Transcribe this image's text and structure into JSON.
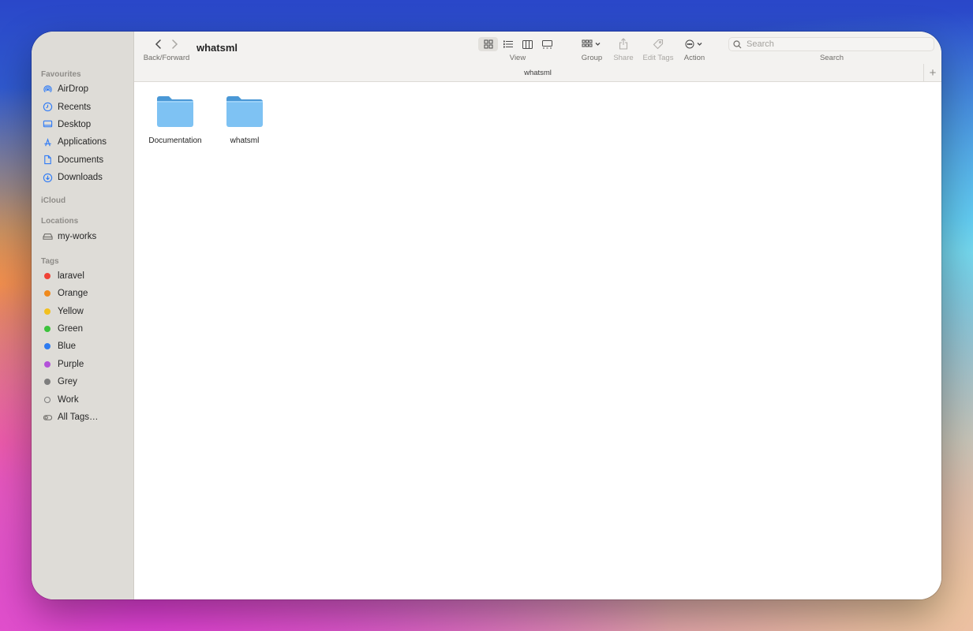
{
  "window": {
    "title": "whatsml",
    "path_title": "whatsml"
  },
  "sidebar": {
    "favourites_label": "Favourites",
    "favourites": [
      {
        "label": "AirDrop",
        "icon": "airdrop-icon"
      },
      {
        "label": "Recents",
        "icon": "clock-icon"
      },
      {
        "label": "Desktop",
        "icon": "desktop-icon"
      },
      {
        "label": "Applications",
        "icon": "applications-icon"
      },
      {
        "label": "Documents",
        "icon": "document-icon"
      },
      {
        "label": "Downloads",
        "icon": "download-icon"
      }
    ],
    "icloud_label": "iCloud",
    "locations_label": "Locations",
    "locations": [
      {
        "label": "my-works",
        "icon": "drive-icon"
      }
    ],
    "tags_label": "Tags",
    "tags": [
      {
        "label": "laravel",
        "color": "#f04236"
      },
      {
        "label": "Orange",
        "color": "#f08a1c"
      },
      {
        "label": "Yellow",
        "color": "#f2c01e"
      },
      {
        "label": "Green",
        "color": "#3cc23c"
      },
      {
        "label": "Blue",
        "color": "#2e7bf0"
      },
      {
        "label": "Purple",
        "color": "#b352d9"
      },
      {
        "label": "Grey",
        "color": "#7d7d7d"
      },
      {
        "label": "Work",
        "color": "outline"
      },
      {
        "label": "All Tags…",
        "color": "all-tags"
      }
    ]
  },
  "toolbar": {
    "back_forward_label": "Back/Forward",
    "view_label": "View",
    "group_label": "Group",
    "share_label": "Share",
    "edit_tags_label": "Edit Tags",
    "action_label": "Action",
    "search_label": "Search",
    "search_placeholder": "Search",
    "accent": "#2f7bf6"
  },
  "files": [
    {
      "name": "Documentation",
      "icon": "folder-icon"
    },
    {
      "name": "whatsml",
      "icon": "folder-icon"
    }
  ]
}
